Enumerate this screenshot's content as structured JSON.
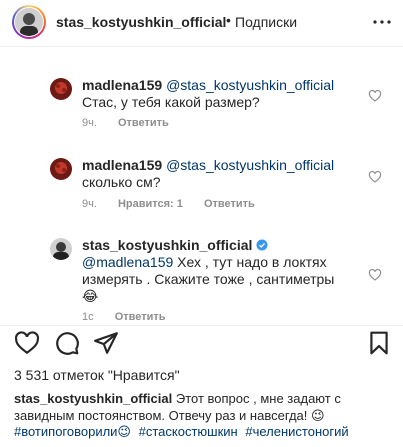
{
  "header": {
    "username": "stas_kostyushkin_official",
    "separator": "•",
    "follow_label": "Подписки",
    "icons": {
      "more": "more-icon",
      "avatar": "avatar"
    }
  },
  "comments": [
    {
      "username": "madlena159",
      "mention": "@stas_kostyushkin_official",
      "text": "Стас, у тебя какой размер?",
      "time": "9ч.",
      "likes": "",
      "reply_label": "Ответить"
    },
    {
      "username": "madlena159",
      "mention": "@stas_kostyushkin_official",
      "text": "сколько см?",
      "time": "9ч.",
      "likes": "Нравится: 1",
      "reply_label": "Ответить"
    },
    {
      "username": "stas_kostyushkin_official",
      "mention": "@madlena159",
      "text": "Хех , тут надо в локтях измерять . Скажите тоже , сантиметры 😂",
      "time": "1с",
      "likes": "",
      "reply_label": "Ответить"
    }
  ],
  "post": {
    "likes_text": "3 531 отметок \"Нравится\"",
    "caption_user": "stas_kostyushkin_official",
    "caption_text": "Этот вопрос , мне задают с завидным постоянством. Отвечу раз и навсегда! 😉",
    "hashtags": [
      "#вотипоговорили😉",
      "#стаскостюшкин",
      "#челенистоногий"
    ]
  },
  "colors": {
    "link": "#00376b",
    "meta": "#8e8e8e",
    "text": "#262626"
  }
}
